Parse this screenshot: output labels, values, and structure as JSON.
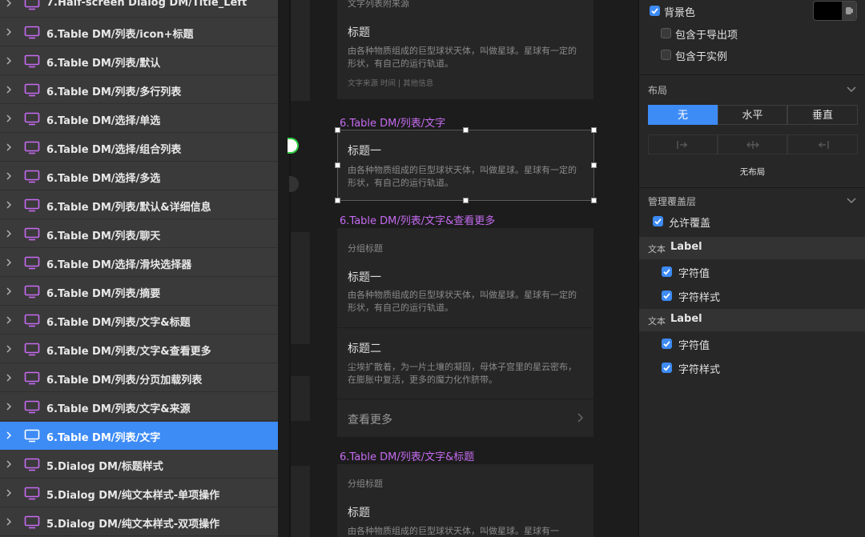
{
  "layers": {
    "items": [
      {
        "label": "7.Half-screen Dialog DM/Title_Left",
        "selected": false
      },
      {
        "label": "6.Table DM/列表/icon+标题",
        "selected": false
      },
      {
        "label": "6.Table DM/列表/默认",
        "selected": false
      },
      {
        "label": "6.Table DM/列表/多行列表",
        "selected": false
      },
      {
        "label": "6.Table DM/选择/单选",
        "selected": false
      },
      {
        "label": "6.Table DM/选择/组合列表",
        "selected": false
      },
      {
        "label": "6.Table DM/选择/多选",
        "selected": false
      },
      {
        "label": "6.Table DM/列表/默认&详细信息",
        "selected": false
      },
      {
        "label": "6.Table DM/列表/聊天",
        "selected": false
      },
      {
        "label": "6.Table DM/选择/滑块选择器",
        "selected": false
      },
      {
        "label": "6.Table DM/列表/摘要",
        "selected": false
      },
      {
        "label": "6.Table DM/列表/文字&标题",
        "selected": false
      },
      {
        "label": "6.Table DM/列表/文字&查看更多",
        "selected": false
      },
      {
        "label": "6.Table DM/列表/分页加载列表",
        "selected": false
      },
      {
        "label": "6.Table DM/列表/文字&来源",
        "selected": false
      },
      {
        "label": "6.Table DM/列表/文字",
        "selected": true
      },
      {
        "label": "5.Dialog DM/标题样式",
        "selected": false
      },
      {
        "label": "5.Dialog DM/纯文本样式-单项操作",
        "selected": false
      },
      {
        "label": "5.Dialog DM/纯文本样式-双项操作",
        "selected": false
      }
    ]
  },
  "canvas": {
    "card_top": {
      "header": "文字列表附来源",
      "title": "标题",
      "body": "由各种物质组成的巨型球状天体，叫做星球。星球有一定的形状，有自己的运行轨道。",
      "meta": "文字来源  时间  |  其他信息"
    },
    "frame_text": {
      "label": "6.Table DM/列表/文字",
      "title": "标题一",
      "body": "由各种物质组成的巨型球状天体，叫做星球。星球有一定的形状，有自己的运行轨道。"
    },
    "frame_more": {
      "label": "6.Table DM/列表/文字&查看更多",
      "group": "分组标题",
      "title1": "标题一",
      "body1": "由各种物质组成的巨型球状天体，叫做星球。星球有一定的形状，有自己的运行轨道。",
      "title2": "标题二",
      "body2": "尘埃扩散着，为一片土壤的凝固，母体子宫里的星云密布，在膨胀中复活，更多的魔力化作脐带。",
      "more": "查看更多"
    },
    "frame_title": {
      "label": "6.Table DM/列表/文字&标题",
      "group": "分组标题",
      "title": "标题",
      "body": "由各种物质组成的巨型球状天体，叫做星球。星球有一"
    }
  },
  "inspector": {
    "background_color_label": "背景色",
    "background_color": "#000000",
    "include_in_export": "包含于导出项",
    "include_in_instance": "包含于实例",
    "layout": {
      "title": "布局",
      "options": [
        "无",
        "水平",
        "垂直"
      ],
      "active": "无",
      "status": "无布局"
    },
    "overrides": {
      "title": "管理覆盖层",
      "allow": "允许覆盖",
      "groups": [
        {
          "kind": "文本",
          "name": "Label",
          "props": [
            "字符值",
            "字符样式"
          ]
        },
        {
          "kind": "文本",
          "name": "Label",
          "props": [
            "字符值",
            "字符样式"
          ]
        }
      ]
    }
  },
  "colors": {
    "accent": "#3d8bf5",
    "frame_label": "#c56bf0",
    "panel": "#3a3a3a",
    "canvas": "#1c1c1c"
  }
}
